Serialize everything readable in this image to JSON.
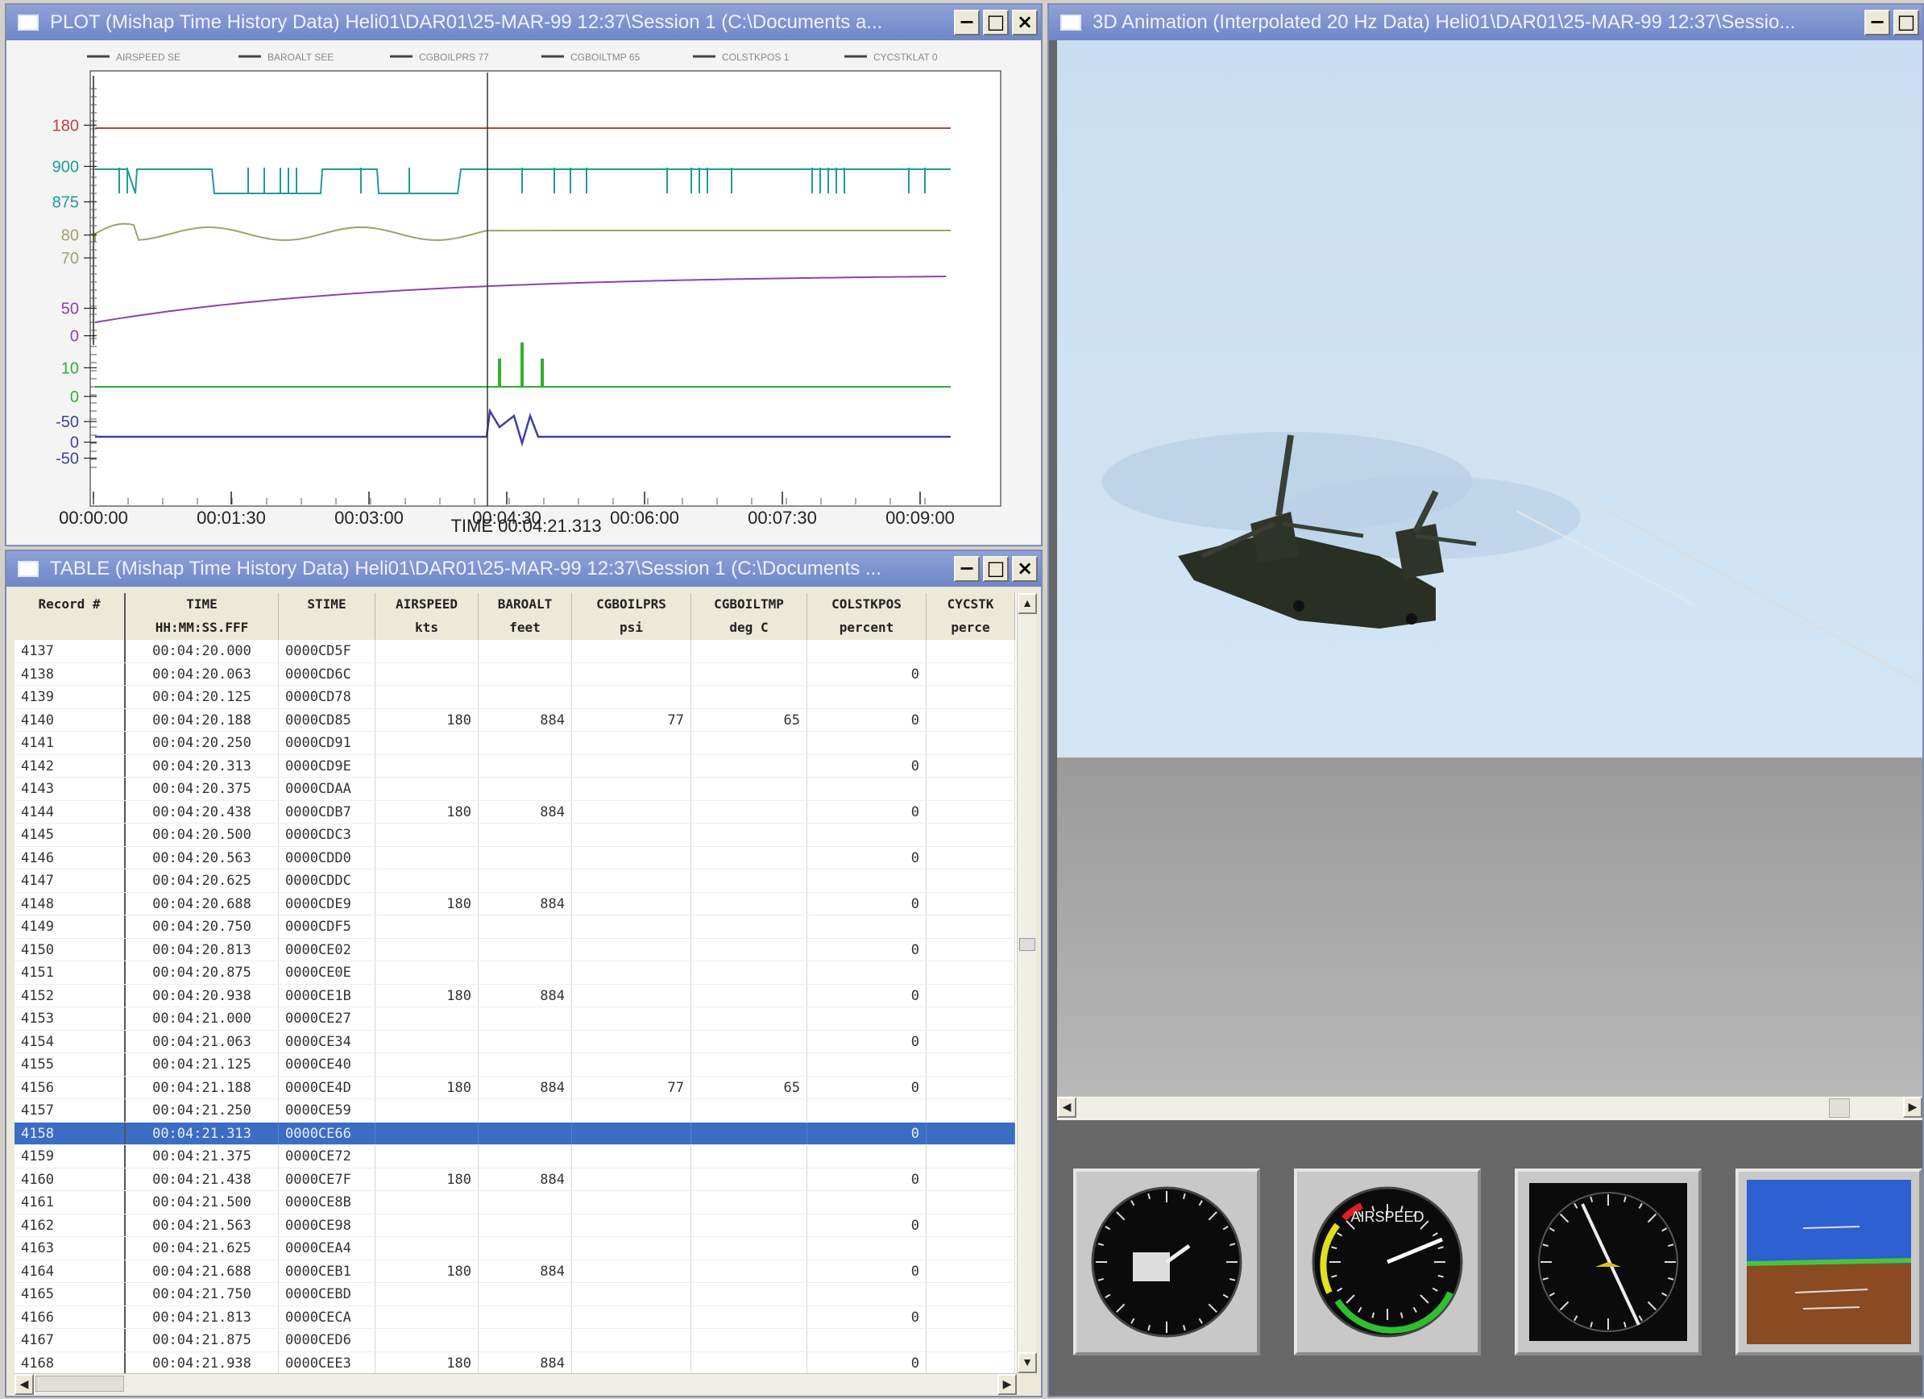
{
  "plot_window": {
    "title": "PLOT (Mishap Time History Data) Heli01\\DAR01\\25-MAR-99 12:37\\Session 1 (C:\\Documents a...",
    "legend": [
      "AIRSPEED  SE",
      "BAROALT  SEE",
      "CGBOILPRS  77",
      "CGBOILTMP  65",
      "COLSTKPOS  1",
      "CYCSTKLAT  0"
    ],
    "cursor_time_label": "TIME 00:04:21.313",
    "y_ticks": [
      "180",
      "900",
      "875",
      "80",
      "70",
      "50",
      "0",
      "10",
      "0",
      "-50",
      "0",
      "-50"
    ],
    "x_ticks": [
      "00:00:00",
      "00:01:30",
      "00:03:00",
      "00:04:30",
      "00:06:00",
      "00:07:30",
      "00:09:00"
    ],
    "colors": {
      "airspeed": "#c04040",
      "baroalt": "#1f9a9a",
      "oilprs": "#a0a070",
      "oiltmp": "#9040b0",
      "colstk": "#30b030",
      "cycstk": "#4040a0"
    }
  },
  "table_window": {
    "title": "TABLE (Mishap Time History Data) Heli01\\DAR01\\25-MAR-99 12:37\\Session 1 (C:\\Documents ...",
    "headers": [
      "Record #",
      "TIME",
      "STIME",
      "AIRSPEED",
      "BAROALT",
      "CGBOILPRS",
      "CGBOILTMP",
      "COLSTKPOS",
      "CYCSTK"
    ],
    "units": [
      "",
      "HH:MM:SS.FFF",
      "",
      "kts",
      "feet",
      "psi",
      "deg C",
      "percent",
      "perce"
    ],
    "rows": [
      [
        "4137",
        "00:04:20.000",
        "0000CD5F",
        "",
        "",
        "",
        "",
        "",
        ""
      ],
      [
        "4138",
        "00:04:20.063",
        "0000CD6C",
        "",
        "",
        "",
        "",
        "0",
        ""
      ],
      [
        "4139",
        "00:04:20.125",
        "0000CD78",
        "",
        "",
        "",
        "",
        "",
        ""
      ],
      [
        "4140",
        "00:04:20.188",
        "0000CD85",
        "180",
        "884",
        "77",
        "65",
        "0",
        ""
      ],
      [
        "4141",
        "00:04:20.250",
        "0000CD91",
        "",
        "",
        "",
        "",
        "",
        ""
      ],
      [
        "4142",
        "00:04:20.313",
        "0000CD9E",
        "",
        "",
        "",
        "",
        "0",
        ""
      ],
      [
        "4143",
        "00:04:20.375",
        "0000CDAA",
        "",
        "",
        "",
        "",
        "",
        ""
      ],
      [
        "4144",
        "00:04:20.438",
        "0000CDB7",
        "180",
        "884",
        "",
        "",
        "0",
        ""
      ],
      [
        "4145",
        "00:04:20.500",
        "0000CDC3",
        "",
        "",
        "",
        "",
        "",
        ""
      ],
      [
        "4146",
        "00:04:20.563",
        "0000CDD0",
        "",
        "",
        "",
        "",
        "0",
        ""
      ],
      [
        "4147",
        "00:04:20.625",
        "0000CDDC",
        "",
        "",
        "",
        "",
        "",
        ""
      ],
      [
        "4148",
        "00:04:20.688",
        "0000CDE9",
        "180",
        "884",
        "",
        "",
        "0",
        ""
      ],
      [
        "4149",
        "00:04:20.750",
        "0000CDF5",
        "",
        "",
        "",
        "",
        "",
        ""
      ],
      [
        "4150",
        "00:04:20.813",
        "0000CE02",
        "",
        "",
        "",
        "",
        "0",
        ""
      ],
      [
        "4151",
        "00:04:20.875",
        "0000CE0E",
        "",
        "",
        "",
        "",
        "",
        ""
      ],
      [
        "4152",
        "00:04:20.938",
        "0000CE1B",
        "180",
        "884",
        "",
        "",
        "0",
        ""
      ],
      [
        "4153",
        "00:04:21.000",
        "0000CE27",
        "",
        "",
        "",
        "",
        "",
        ""
      ],
      [
        "4154",
        "00:04:21.063",
        "0000CE34",
        "",
        "",
        "",
        "",
        "0",
        ""
      ],
      [
        "4155",
        "00:04:21.125",
        "0000CE40",
        "",
        "",
        "",
        "",
        "",
        ""
      ],
      [
        "4156",
        "00:04:21.188",
        "0000CE4D",
        "180",
        "884",
        "77",
        "65",
        "0",
        ""
      ],
      [
        "4157",
        "00:04:21.250",
        "0000CE59",
        "",
        "",
        "",
        "",
        "",
        ""
      ],
      [
        "4158",
        "00:04:21.313",
        "0000CE66",
        "",
        "",
        "",
        "",
        "0",
        ""
      ],
      [
        "4159",
        "00:04:21.375",
        "0000CE72",
        "",
        "",
        "",
        "",
        "",
        ""
      ],
      [
        "4160",
        "00:04:21.438",
        "0000CE7F",
        "180",
        "884",
        "",
        "",
        "0",
        ""
      ],
      [
        "4161",
        "00:04:21.500",
        "0000CE8B",
        "",
        "",
        "",
        "",
        "",
        ""
      ],
      [
        "4162",
        "00:04:21.563",
        "0000CE98",
        "",
        "",
        "",
        "",
        "0",
        ""
      ],
      [
        "4163",
        "00:04:21.625",
        "0000CEA4",
        "",
        "",
        "",
        "",
        "",
        ""
      ],
      [
        "4164",
        "00:04:21.688",
        "0000CEB1",
        "180",
        "884",
        "",
        "",
        "0",
        ""
      ],
      [
        "4165",
        "00:04:21.750",
        "0000CEBD",
        "",
        "",
        "",
        "",
        "",
        ""
      ],
      [
        "4166",
        "00:04:21.813",
        "0000CECA",
        "",
        "",
        "",
        "",
        "0",
        ""
      ],
      [
        "4167",
        "00:04:21.875",
        "0000CED6",
        "",
        "",
        "",
        "",
        "",
        ""
      ],
      [
        "4168",
        "00:04:21.938",
        "0000CEE3",
        "180",
        "884",
        "",
        "",
        "0",
        ""
      ]
    ],
    "selected_record": "4158"
  },
  "anim_window": {
    "title": "3D Animation (Interpolated 20 Hz Data) Heli01\\DAR01\\25-MAR-99 12:37\\Sessio...",
    "airspeed_gauge_label": "AIRSPEED",
    "colors": {
      "sky": "#cfe2f2",
      "ground": "#a8a8a8"
    }
  },
  "icons": [
    "window-icon",
    "minimize-icon",
    "maximize-icon",
    "close-icon",
    "scroll-up-icon",
    "scroll-down-icon",
    "scroll-left-icon",
    "scroll-right-icon"
  ]
}
